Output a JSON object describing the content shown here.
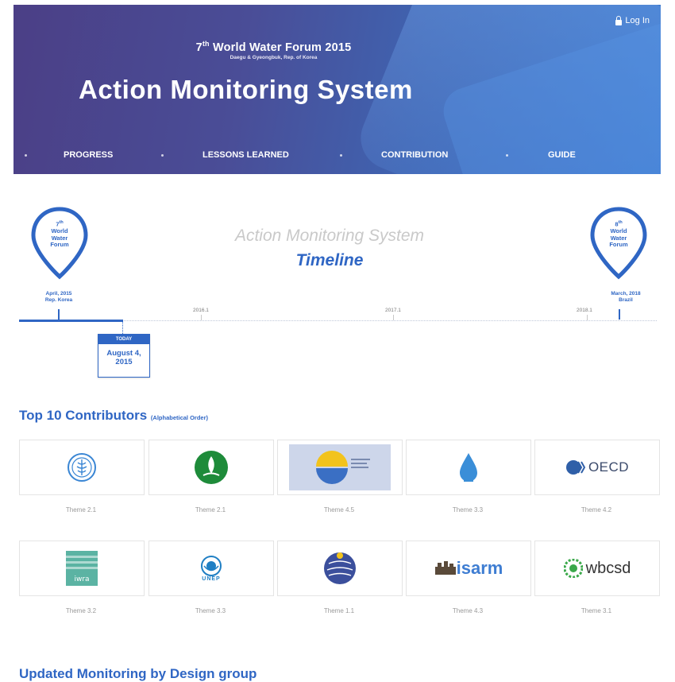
{
  "header": {
    "login_label": "Log In",
    "forum_title_ordinal": "7",
    "forum_title_suffix": "th",
    "forum_title_rest": " World Water Forum 2015",
    "forum_subtitle": "Daegu & Gyeongbuk, Rep. of Korea",
    "app_title": "Action Monitoring System"
  },
  "nav": {
    "items": [
      {
        "label": "PROGRESS"
      },
      {
        "label": "LESSONS LEARNED"
      },
      {
        "label": "CONTRIBUTION"
      },
      {
        "label": "GUIDE"
      }
    ]
  },
  "timeline": {
    "caption_line1": "Action Monitoring System",
    "caption_line2": "Timeline",
    "start_pin": {
      "ordinal": "7",
      "suffix": "th",
      "lines": [
        "World",
        "Water",
        "Forum"
      ]
    },
    "end_pin": {
      "ordinal": "8",
      "suffix": "th",
      "lines": [
        "World",
        "Water",
        "Forum"
      ]
    },
    "start_date": {
      "line1": "April, 2015",
      "line2": "Rep. Korea"
    },
    "end_date": {
      "line1": "March, 2018",
      "line2": "Brazil"
    },
    "years": [
      "2016.1",
      "2017.1",
      "2018.1"
    ],
    "today_label": "TODAY",
    "today_date_line1": "August 4,",
    "today_date_line2": "2015",
    "progress_fraction": 0.04
  },
  "contributors": {
    "title": "Top 10 Contributors",
    "title_note": "(Alphabetical Order)",
    "items": [
      {
        "logo": "fao-logo",
        "theme": "Theme 2.1"
      },
      {
        "logo": "gwp-logo",
        "theme": "Theme 2.1"
      },
      {
        "logo": "banner-logo",
        "theme": "Theme 4.5"
      },
      {
        "logo": "water-drop-logo",
        "theme": "Theme 3.3"
      },
      {
        "logo": "oecd-logo",
        "logo_text": "OECD",
        "theme": "Theme 4.2"
      },
      {
        "logo": "iwra-logo",
        "logo_text": "iwra",
        "theme": "Theme 3.2"
      },
      {
        "logo": "unep-logo",
        "logo_text": "UNEP",
        "theme": "Theme 3.3"
      },
      {
        "logo": "globe-logo",
        "theme": "Theme 1.1"
      },
      {
        "logo": "isarm-logo",
        "logo_text": "isarm",
        "theme": "Theme 4.3"
      },
      {
        "logo": "wbcsd-logo",
        "logo_text": "wbcsd",
        "theme": "Theme 3.1"
      }
    ]
  },
  "updated": {
    "title": "Updated Monitoring by Design group"
  },
  "colors": {
    "accent": "#2f66c4",
    "banner_left": "#4b3f86",
    "banner_right": "#3a7ad0"
  }
}
